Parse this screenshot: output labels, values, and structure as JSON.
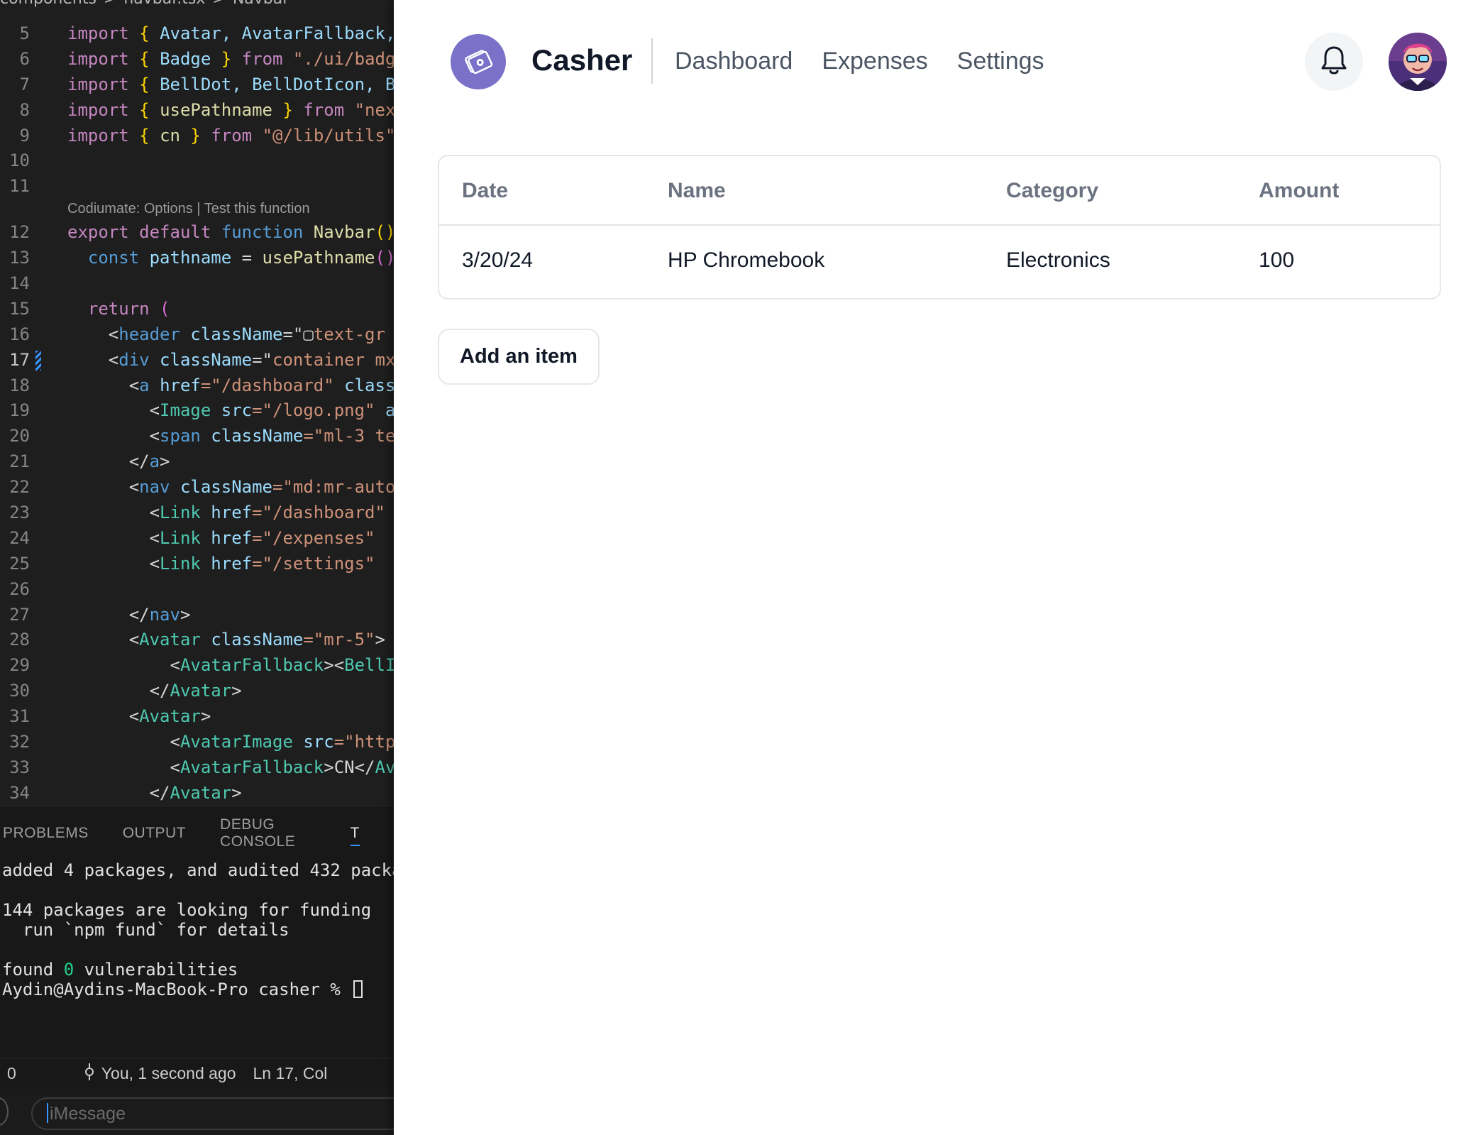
{
  "editor": {
    "breadcrumb": [
      "components",
      ">",
      "navbar.tsx",
      ">",
      "Navbar"
    ],
    "codelens": "Codiumate: Options | Test this function",
    "line_numbers": [
      "5",
      "6",
      "7",
      "8",
      "9",
      "10",
      "11",
      "12",
      "13",
      "14",
      "15",
      "16",
      "17",
      "18",
      "19",
      "20",
      "21",
      "22",
      "23",
      "24",
      "25",
      "26",
      "27",
      "28",
      "29",
      "30",
      "31",
      "32",
      "33",
      "34"
    ],
    "lines": [
      [
        [
          "import ",
          "k"
        ],
        [
          "{ ",
          "br"
        ],
        [
          "Avatar, AvatarFallback,",
          "v"
        ]
      ],
      [
        [
          "import ",
          "k"
        ],
        [
          "{ ",
          "br"
        ],
        [
          "Badge ",
          "v"
        ],
        [
          "} ",
          "br"
        ],
        [
          "from ",
          "k"
        ],
        [
          "\"./ui/badg",
          "s"
        ]
      ],
      [
        [
          "import ",
          "k"
        ],
        [
          "{ ",
          "br"
        ],
        [
          "BellDot, BellDotIcon, B",
          "v"
        ]
      ],
      [
        [
          "import ",
          "k"
        ],
        [
          "{ ",
          "br"
        ],
        [
          "usePathname ",
          "f"
        ],
        [
          "} ",
          "br"
        ],
        [
          "from ",
          "k"
        ],
        [
          "\"nex",
          "s"
        ]
      ],
      [
        [
          "import ",
          "k"
        ],
        [
          "{ ",
          "br"
        ],
        [
          "cn ",
          "f"
        ],
        [
          "} ",
          "br"
        ],
        [
          "from ",
          "k"
        ],
        [
          "\"@/lib/utils\"",
          "s"
        ]
      ],
      [],
      [],
      [
        [
          "export ",
          "k"
        ],
        [
          "default ",
          "k"
        ],
        [
          "function ",
          "k2"
        ],
        [
          "Navbar",
          "f"
        ],
        [
          "()",
          "br"
        ]
      ],
      [
        [
          "  const ",
          "k2"
        ],
        [
          "pathname ",
          "v"
        ],
        [
          "= ",
          "p"
        ],
        [
          "usePathname",
          "f"
        ],
        [
          "()",
          "br2"
        ]
      ],
      [],
      [
        [
          "  return ",
          "k"
        ],
        [
          "(",
          "br2"
        ]
      ],
      [
        [
          "    <",
          "p"
        ],
        [
          "header ",
          "tg"
        ],
        [
          "className",
          "v"
        ],
        [
          "=\"",
          "p"
        ],
        [
          "▢",
          "p"
        ],
        [
          "text-gr",
          "s"
        ]
      ],
      [
        [
          "    <",
          "p"
        ],
        [
          "div ",
          "tg"
        ],
        [
          "className",
          "v"
        ],
        [
          "=\"",
          "p"
        ],
        [
          "container mx",
          "s"
        ]
      ],
      [
        [
          "      <",
          "p"
        ],
        [
          "a ",
          "tg"
        ],
        [
          "href",
          "v"
        ],
        [
          "=\"/dashboard\" ",
          "s"
        ],
        [
          "class",
          "v"
        ]
      ],
      [
        [
          "        <",
          "p"
        ],
        [
          "Image ",
          "t"
        ],
        [
          "src",
          "v"
        ],
        [
          "=\"/logo.png\" ",
          "s"
        ],
        [
          "a",
          "v"
        ]
      ],
      [
        [
          "        <",
          "p"
        ],
        [
          "span ",
          "tg"
        ],
        [
          "className",
          "v"
        ],
        [
          "=\"ml-3 te",
          "s"
        ]
      ],
      [
        [
          "      </",
          "p"
        ],
        [
          "a",
          "tg"
        ],
        [
          ">",
          "p"
        ]
      ],
      [
        [
          "      <",
          "p"
        ],
        [
          "nav ",
          "tg"
        ],
        [
          "className",
          "v"
        ],
        [
          "=\"md:mr-auto",
          "s"
        ]
      ],
      [
        [
          "        <",
          "p"
        ],
        [
          "Link ",
          "t"
        ],
        [
          "href",
          "v"
        ],
        [
          "=\"/dashboard\"",
          "s"
        ]
      ],
      [
        [
          "        <",
          "p"
        ],
        [
          "Link ",
          "t"
        ],
        [
          "href",
          "v"
        ],
        [
          "=\"/expenses\"",
          "s"
        ]
      ],
      [
        [
          "        <",
          "p"
        ],
        [
          "Link ",
          "t"
        ],
        [
          "href",
          "v"
        ],
        [
          "=\"/settings\"",
          "s"
        ]
      ],
      [],
      [
        [
          "      </",
          "p"
        ],
        [
          "nav",
          "tg"
        ],
        [
          ">",
          "p"
        ]
      ],
      [
        [
          "      <",
          "p"
        ],
        [
          "Avatar ",
          "t"
        ],
        [
          "className",
          "v"
        ],
        [
          "=\"mr-5\"",
          "s"
        ],
        [
          ">",
          "p"
        ]
      ],
      [
        [
          "          <",
          "p"
        ],
        [
          "AvatarFallback",
          "t"
        ],
        [
          "><",
          "p"
        ],
        [
          "BellI",
          "t"
        ]
      ],
      [
        [
          "        </",
          "p"
        ],
        [
          "Avatar",
          "t"
        ],
        [
          ">",
          "p"
        ]
      ],
      [
        [
          "      <",
          "p"
        ],
        [
          "Avatar",
          "t"
        ],
        [
          ">",
          "p"
        ]
      ],
      [
        [
          "          <",
          "p"
        ],
        [
          "AvatarImage ",
          "t"
        ],
        [
          "src",
          "v"
        ],
        [
          "=\"http",
          "s"
        ]
      ],
      [
        [
          "          <",
          "p"
        ],
        [
          "AvatarFallback",
          "t"
        ],
        [
          ">CN</",
          "p"
        ],
        [
          "Av",
          "t"
        ]
      ],
      [
        [
          "        </",
          "p"
        ],
        [
          "Avatar",
          "t"
        ],
        [
          ">",
          "p"
        ]
      ]
    ],
    "panel_tabs": [
      "PROBLEMS",
      "OUTPUT",
      "DEBUG CONSOLE",
      "T"
    ],
    "terminal": {
      "line1": "added 4 packages, and audited 432 packag",
      "line2": "144 packages are looking for funding",
      "line3": "  run `npm fund` for details",
      "line4_pre": "found ",
      "line4_num": "0",
      "line4_post": " vulnerabilities",
      "prompt": "Aydin@Aydins-MacBook-Pro casher % "
    },
    "status": {
      "errors": "0",
      "git": "You, 1 second ago",
      "position": "Ln 17, Col"
    },
    "imessage_placeholder": "iMessage"
  },
  "app": {
    "brand": "Casher",
    "nav": [
      "Dashboard",
      "Expenses",
      "Settings"
    ],
    "table": {
      "headers": [
        "Date",
        "Name",
        "Category",
        "Amount"
      ],
      "rows": [
        [
          "3/20/24",
          "HP Chromebook",
          "Electronics",
          "100"
        ]
      ]
    },
    "add_button": "Add an item",
    "colors": {
      "logo_bg": "#7b71c9",
      "text": "#111827",
      "muted": "#6b7280",
      "border": "#e5e7eb"
    }
  }
}
